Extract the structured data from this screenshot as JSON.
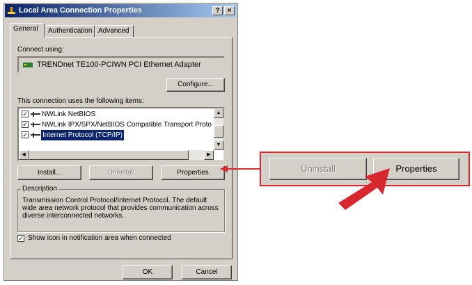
{
  "window": {
    "title": "Local Area Connection Properties",
    "help_button": "?",
    "close_button": "×"
  },
  "tabs": [
    {
      "label": "General"
    },
    {
      "label": "Authentication"
    },
    {
      "label": "Advanced"
    }
  ],
  "general": {
    "connect_using_label": "Connect using:",
    "adapter_name": "TRENDnet TE100-PCIWN PCI Ethernet Adapter",
    "configure_button": "Configure...",
    "items_label": "This connection uses the following items:",
    "items": [
      {
        "label": "NWLink NetBIOS",
        "checked": true,
        "selected": false
      },
      {
        "label": "NWLink IPX/SPX/NetBIOS Compatible Transport Proto",
        "checked": true,
        "selected": false
      },
      {
        "label": "Internet Protocol (TCP/IP)",
        "checked": true,
        "selected": true
      }
    ],
    "install_button": "Install...",
    "uninstall_button": "Uninstall",
    "properties_button": "Properties",
    "description_title": "Description",
    "description_text": "Transmission Control Protocol/Internet Protocol. The default wide area network protocol that provides communication across diverse interconnected networks.",
    "show_icon_label": "Show icon in notification area when connected",
    "show_icon_checked": true
  },
  "footer": {
    "ok_button": "OK",
    "cancel_button": "Cancel"
  },
  "callout": {
    "uninstall_button": "Uninstall",
    "properties_button": "Properties"
  },
  "colors": {
    "accent_red": "#d7282f",
    "title_bar": "#0a246a",
    "dialog_bg": "#d4d0c8",
    "selection": "#0a246a"
  }
}
